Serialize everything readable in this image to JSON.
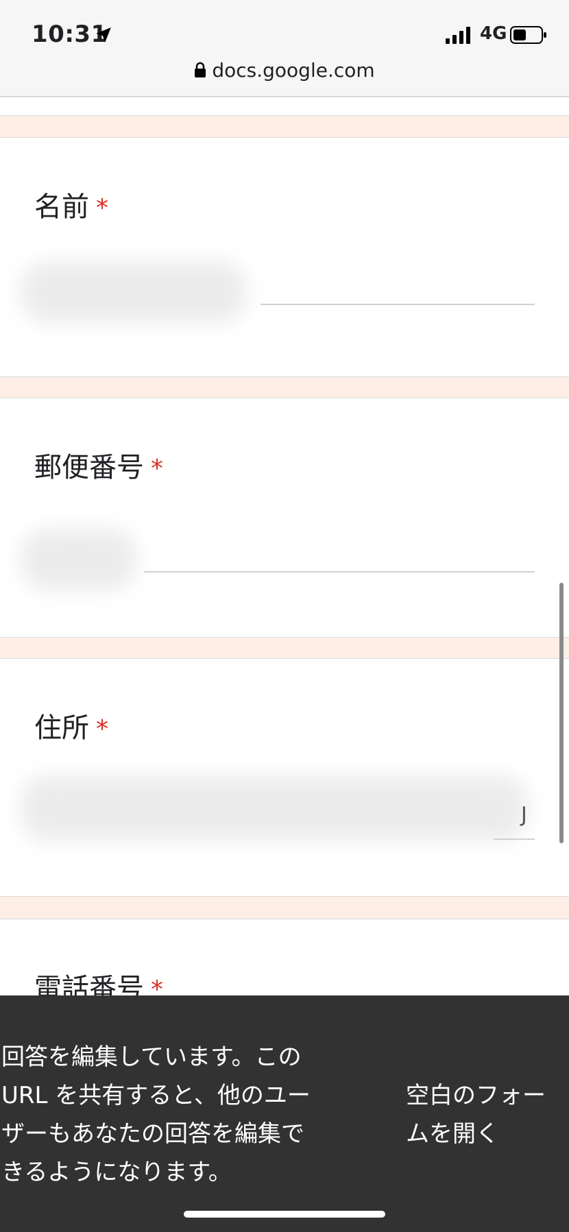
{
  "status_bar": {
    "time": "10:31",
    "network": "4G"
  },
  "browser": {
    "url": "docs.google.com"
  },
  "form": {
    "questions": [
      {
        "label": "名前",
        "required_mark": "*"
      },
      {
        "label": "郵便番号",
        "required_mark": "*"
      },
      {
        "label": "住所",
        "required_mark": "*",
        "visible_tail": "J"
      },
      {
        "label": "電話番号",
        "required_mark": "*"
      }
    ]
  },
  "snackbar": {
    "message": "回答を編集しています。このURL を共有すると、他のユーザーもあなたの回答を編集できるようになります。",
    "action": "空白のフォームを開く"
  },
  "colors": {
    "accent_required": "#d93025",
    "page_background": "#fdeee6",
    "snackbar_background": "#323232"
  }
}
